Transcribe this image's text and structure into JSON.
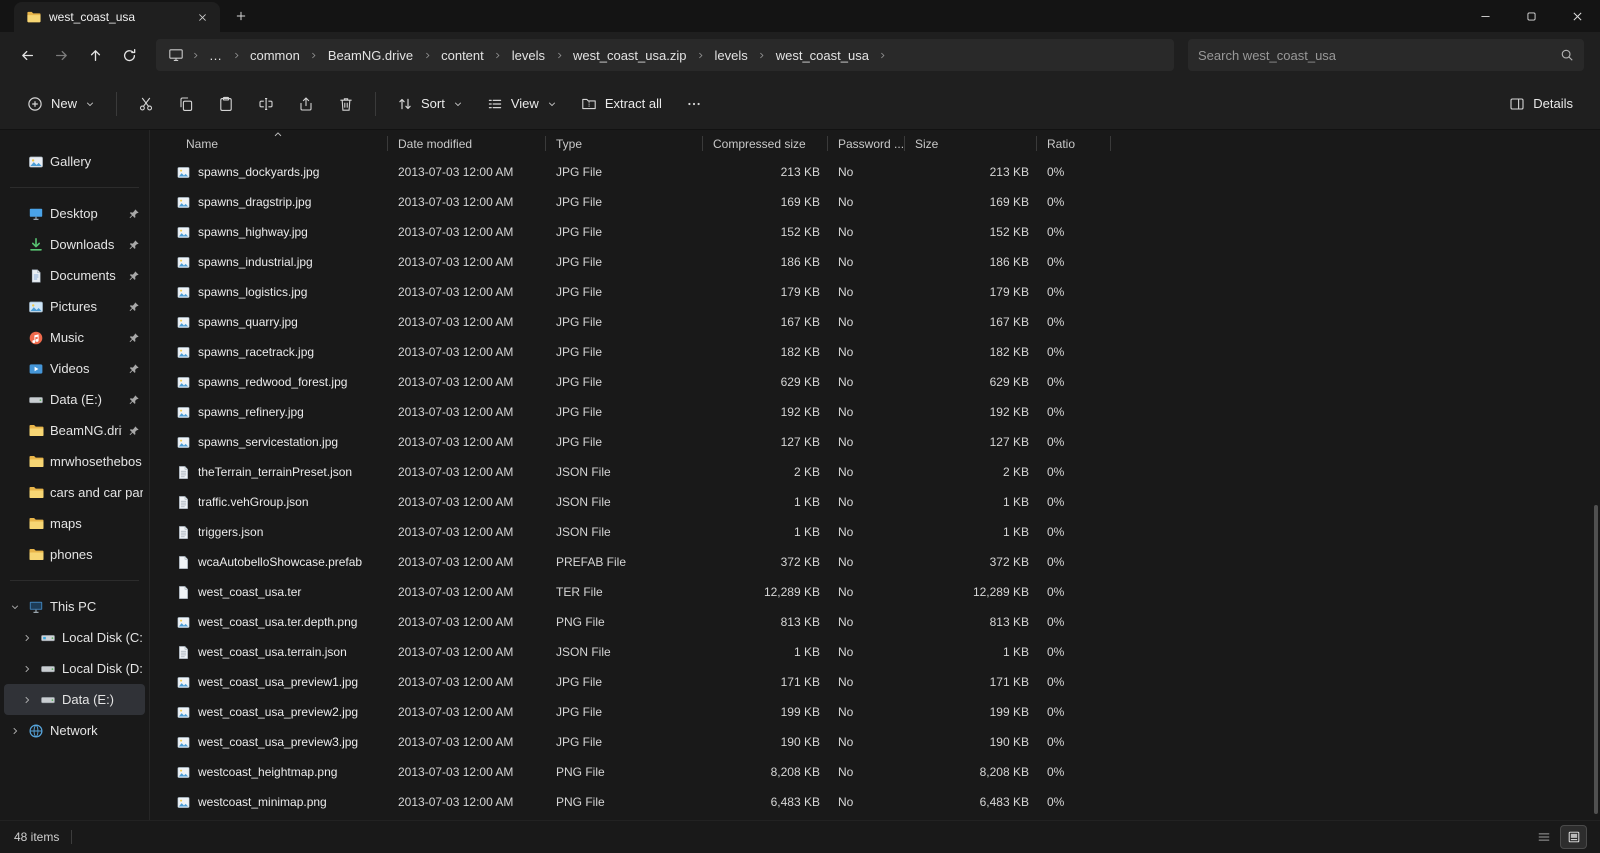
{
  "window": {
    "tab_title": "west_coast_usa",
    "items_count": "48 items"
  },
  "nav": {
    "ellipsis": "…",
    "breadcrumbs": [
      "common",
      "BeamNG.drive",
      "content",
      "levels",
      "west_coast_usa.zip",
      "levels",
      "west_coast_usa"
    ],
    "search_placeholder": "Search west_coast_usa"
  },
  "toolbar": {
    "new": "New",
    "sort": "Sort",
    "view": "View",
    "extract": "Extract all",
    "details": "Details"
  },
  "sidebar": {
    "items": [
      {
        "label": "Gallery",
        "icon": "gallery"
      },
      {
        "divider": true
      },
      {
        "label": "Desktop",
        "icon": "desktop",
        "pinned": true
      },
      {
        "label": "Downloads",
        "icon": "downloads",
        "pinned": true
      },
      {
        "label": "Documents",
        "icon": "documents",
        "pinned": true
      },
      {
        "label": "Pictures",
        "icon": "pictures",
        "pinned": true
      },
      {
        "label": "Music",
        "icon": "music",
        "pinned": true
      },
      {
        "label": "Videos",
        "icon": "videos",
        "pinned": true
      },
      {
        "label": "Data (E:)",
        "icon": "drive",
        "pinned": true
      },
      {
        "label": "BeamNG.driv",
        "icon": "folder",
        "pinned": true
      },
      {
        "label": "mrwhosethebos",
        "icon": "folder"
      },
      {
        "label": "cars and car par",
        "icon": "folder"
      },
      {
        "label": "maps",
        "icon": "folder"
      },
      {
        "label": "phones",
        "icon": "folder"
      },
      {
        "divider": true
      },
      {
        "label": "This PC",
        "icon": "pc",
        "chev": "down"
      },
      {
        "label": "Local Disk (C:)",
        "icon": "drive-os",
        "chev": "right",
        "indent": true
      },
      {
        "label": "Local Disk (D:)",
        "icon": "drive",
        "chev": "right",
        "indent": true
      },
      {
        "label": "Data (E:)",
        "icon": "drive",
        "chev": "right",
        "indent": true,
        "selected": true
      },
      {
        "label": "Network",
        "icon": "network",
        "chev": "right"
      }
    ]
  },
  "list": {
    "columns": [
      "Name",
      "Date modified",
      "Type",
      "Compressed size",
      "Password ...",
      "Size",
      "Ratio"
    ],
    "files": [
      {
        "name": "spawns_dockyards.jpg",
        "modified": "2013-07-03 12:00 AM",
        "type": "JPG File",
        "compressed": "213 KB",
        "password": "No",
        "size": "213 KB",
        "ratio": "0%",
        "icon": "image-file"
      },
      {
        "name": "spawns_dragstrip.jpg",
        "modified": "2013-07-03 12:00 AM",
        "type": "JPG File",
        "compressed": "169 KB",
        "password": "No",
        "size": "169 KB",
        "ratio": "0%",
        "icon": "image-file"
      },
      {
        "name": "spawns_highway.jpg",
        "modified": "2013-07-03 12:00 AM",
        "type": "JPG File",
        "compressed": "152 KB",
        "password": "No",
        "size": "152 KB",
        "ratio": "0%",
        "icon": "image-file"
      },
      {
        "name": "spawns_industrial.jpg",
        "modified": "2013-07-03 12:00 AM",
        "type": "JPG File",
        "compressed": "186 KB",
        "password": "No",
        "size": "186 KB",
        "ratio": "0%",
        "icon": "image-file"
      },
      {
        "name": "spawns_logistics.jpg",
        "modified": "2013-07-03 12:00 AM",
        "type": "JPG File",
        "compressed": "179 KB",
        "password": "No",
        "size": "179 KB",
        "ratio": "0%",
        "icon": "image-file"
      },
      {
        "name": "spawns_quarry.jpg",
        "modified": "2013-07-03 12:00 AM",
        "type": "JPG File",
        "compressed": "167 KB",
        "password": "No",
        "size": "167 KB",
        "ratio": "0%",
        "icon": "image-file"
      },
      {
        "name": "spawns_racetrack.jpg",
        "modified": "2013-07-03 12:00 AM",
        "type": "JPG File",
        "compressed": "182 KB",
        "password": "No",
        "size": "182 KB",
        "ratio": "0%",
        "icon": "image-file"
      },
      {
        "name": "spawns_redwood_forest.jpg",
        "modified": "2013-07-03 12:00 AM",
        "type": "JPG File",
        "compressed": "629 KB",
        "password": "No",
        "size": "629 KB",
        "ratio": "0%",
        "icon": "image-file"
      },
      {
        "name": "spawns_refinery.jpg",
        "modified": "2013-07-03 12:00 AM",
        "type": "JPG File",
        "compressed": "192 KB",
        "password": "No",
        "size": "192 KB",
        "ratio": "0%",
        "icon": "image-file"
      },
      {
        "name": "spawns_servicestation.jpg",
        "modified": "2013-07-03 12:00 AM",
        "type": "JPG File",
        "compressed": "127 KB",
        "password": "No",
        "size": "127 KB",
        "ratio": "0%",
        "icon": "image-file"
      },
      {
        "name": "theTerrain_terrainPreset.json",
        "modified": "2013-07-03 12:00 AM",
        "type": "JSON File",
        "compressed": "2 KB",
        "password": "No",
        "size": "2 KB",
        "ratio": "0%",
        "icon": "doc-lines-file"
      },
      {
        "name": "traffic.vehGroup.json",
        "modified": "2013-07-03 12:00 AM",
        "type": "JSON File",
        "compressed": "1 KB",
        "password": "No",
        "size": "1 KB",
        "ratio": "0%",
        "icon": "doc-lines-file"
      },
      {
        "name": "triggers.json",
        "modified": "2013-07-03 12:00 AM",
        "type": "JSON File",
        "compressed": "1 KB",
        "password": "No",
        "size": "1 KB",
        "ratio": "0%",
        "icon": "doc-lines-file"
      },
      {
        "name": "wcaAutobelloShowcase.prefab",
        "modified": "2013-07-03 12:00 AM",
        "type": "PREFAB File",
        "compressed": "372 KB",
        "password": "No",
        "size": "372 KB",
        "ratio": "0%",
        "icon": "doc-file"
      },
      {
        "name": "west_coast_usa.ter",
        "modified": "2013-07-03 12:00 AM",
        "type": "TER File",
        "compressed": "12,289 KB",
        "password": "No",
        "size": "12,289 KB",
        "ratio": "0%",
        "icon": "doc-file"
      },
      {
        "name": "west_coast_usa.ter.depth.png",
        "modified": "2013-07-03 12:00 AM",
        "type": "PNG File",
        "compressed": "813 KB",
        "password": "No",
        "size": "813 KB",
        "ratio": "0%",
        "icon": "image-file"
      },
      {
        "name": "west_coast_usa.terrain.json",
        "modified": "2013-07-03 12:00 AM",
        "type": "JSON File",
        "compressed": "1 KB",
        "password": "No",
        "size": "1 KB",
        "ratio": "0%",
        "icon": "doc-lines-file"
      },
      {
        "name": "west_coast_usa_preview1.jpg",
        "modified": "2013-07-03 12:00 AM",
        "type": "JPG File",
        "compressed": "171 KB",
        "password": "No",
        "size": "171 KB",
        "ratio": "0%",
        "icon": "image-file"
      },
      {
        "name": "west_coast_usa_preview2.jpg",
        "modified": "2013-07-03 12:00 AM",
        "type": "JPG File",
        "compressed": "199 KB",
        "password": "No",
        "size": "199 KB",
        "ratio": "0%",
        "icon": "image-file"
      },
      {
        "name": "west_coast_usa_preview3.jpg",
        "modified": "2013-07-03 12:00 AM",
        "type": "JPG File",
        "compressed": "190 KB",
        "password": "No",
        "size": "190 KB",
        "ratio": "0%",
        "icon": "image-file"
      },
      {
        "name": "westcoast_heightmap.png",
        "modified": "2013-07-03 12:00 AM",
        "type": "PNG File",
        "compressed": "8,208 KB",
        "password": "No",
        "size": "8,208 KB",
        "ratio": "0%",
        "icon": "image-file"
      },
      {
        "name": "westcoast_minimap.png",
        "modified": "2013-07-03 12:00 AM",
        "type": "PNG File",
        "compressed": "6,483 KB",
        "password": "No",
        "size": "6,483 KB",
        "ratio": "0%",
        "icon": "image-file"
      }
    ]
  }
}
